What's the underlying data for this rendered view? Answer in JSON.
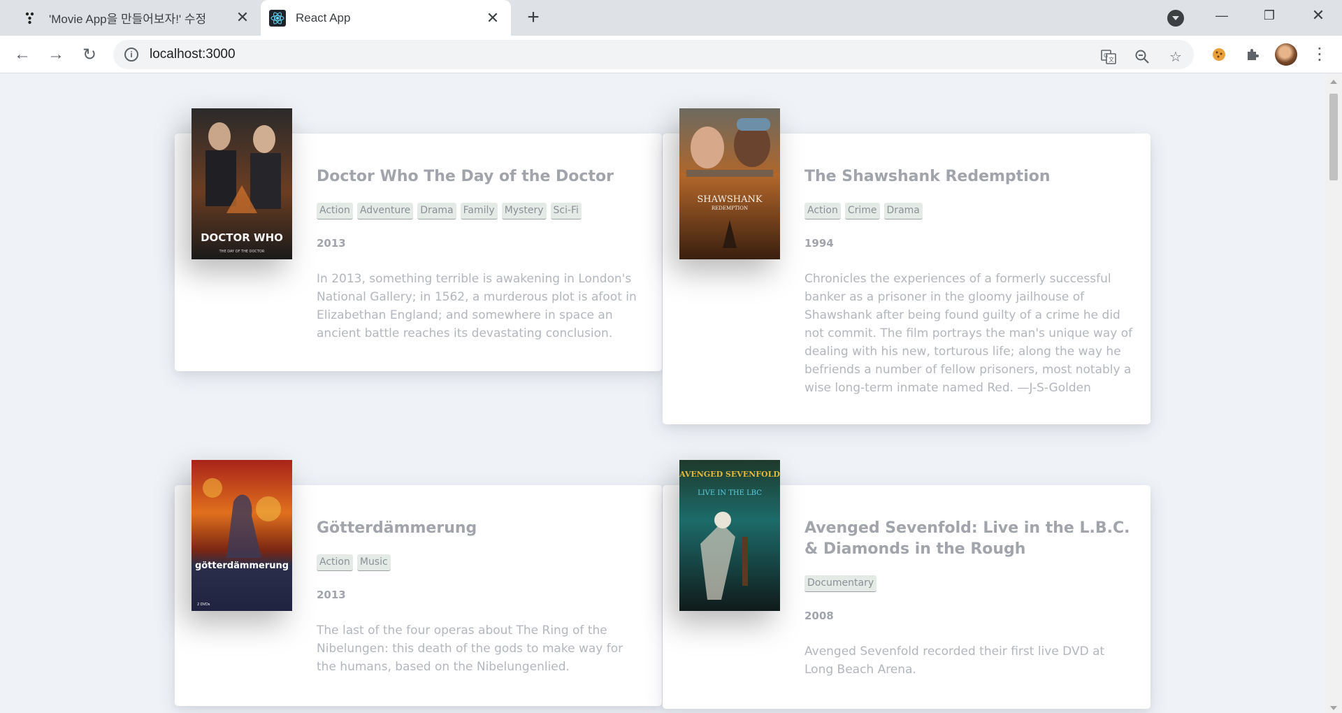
{
  "browser": {
    "tabs": [
      {
        "title": "'Movie App을 만들어보자!' 수정",
        "active": false
      },
      {
        "title": "React App",
        "active": true
      }
    ],
    "new_tab_label": "+",
    "url": "localhost:3000",
    "window_controls": {
      "minimize": "—",
      "restore": "❐",
      "close": "✕"
    },
    "extensions": [
      "translate-icon",
      "zoom-out-icon",
      "bookmark-star-icon",
      "cookie-icon",
      "puzzle-icon"
    ]
  },
  "movies": [
    {
      "title": "Doctor Who The Day of the Doctor",
      "genres": [
        "Action",
        "Adventure",
        "Drama",
        "Family",
        "Mystery",
        "Sci-Fi"
      ],
      "year": "2013",
      "summary": "In 2013, something terrible is awakening in London's National Gallery; in 1562, a murderous plot is afoot in Elizabethan England; and somewhere in space an ancient battle reaches its devastating conclusion.",
      "poster_text": "DOCTOR WHO",
      "poster_sub": "THE DAY OF THE DOCTOR"
    },
    {
      "title": "The Shawshank Redemption",
      "genres": [
        "Action",
        "Crime",
        "Drama"
      ],
      "year": "1994",
      "summary": "Chronicles the experiences of a formerly successful banker as a prisoner in the gloomy jailhouse of Shawshank after being found guilty of a crime he did not commit. The film portrays the man's unique way of dealing with his new, torturous life; along the way he befriends a number of fellow prisoners, most notably a wise long-term inmate named Red. —J-S-Golden",
      "poster_text": "SHAWSHANK",
      "poster_sub": "REDEMPTION"
    },
    {
      "title": "Götterdämmerung",
      "genres": [
        "Action",
        "Music"
      ],
      "year": "2013",
      "summary": "The last of the four operas about The Ring of the Nibelungen: this death of the gods to make way for the humans, based on the Nibelungenlied.",
      "poster_text": "götterdämmerung",
      "poster_sub": "2 DVDs"
    },
    {
      "title": "Avenged Sevenfold: Live in the L.B.C. & Diamonds in the Rough",
      "genres": [
        "Documentary"
      ],
      "year": "2008",
      "summary": "Avenged Sevenfold recorded their first live DVD at Long Beach Arena.",
      "poster_text": "AVENGED SEVENFOLD",
      "poster_sub": "LIVE IN THE LBC"
    }
  ]
}
